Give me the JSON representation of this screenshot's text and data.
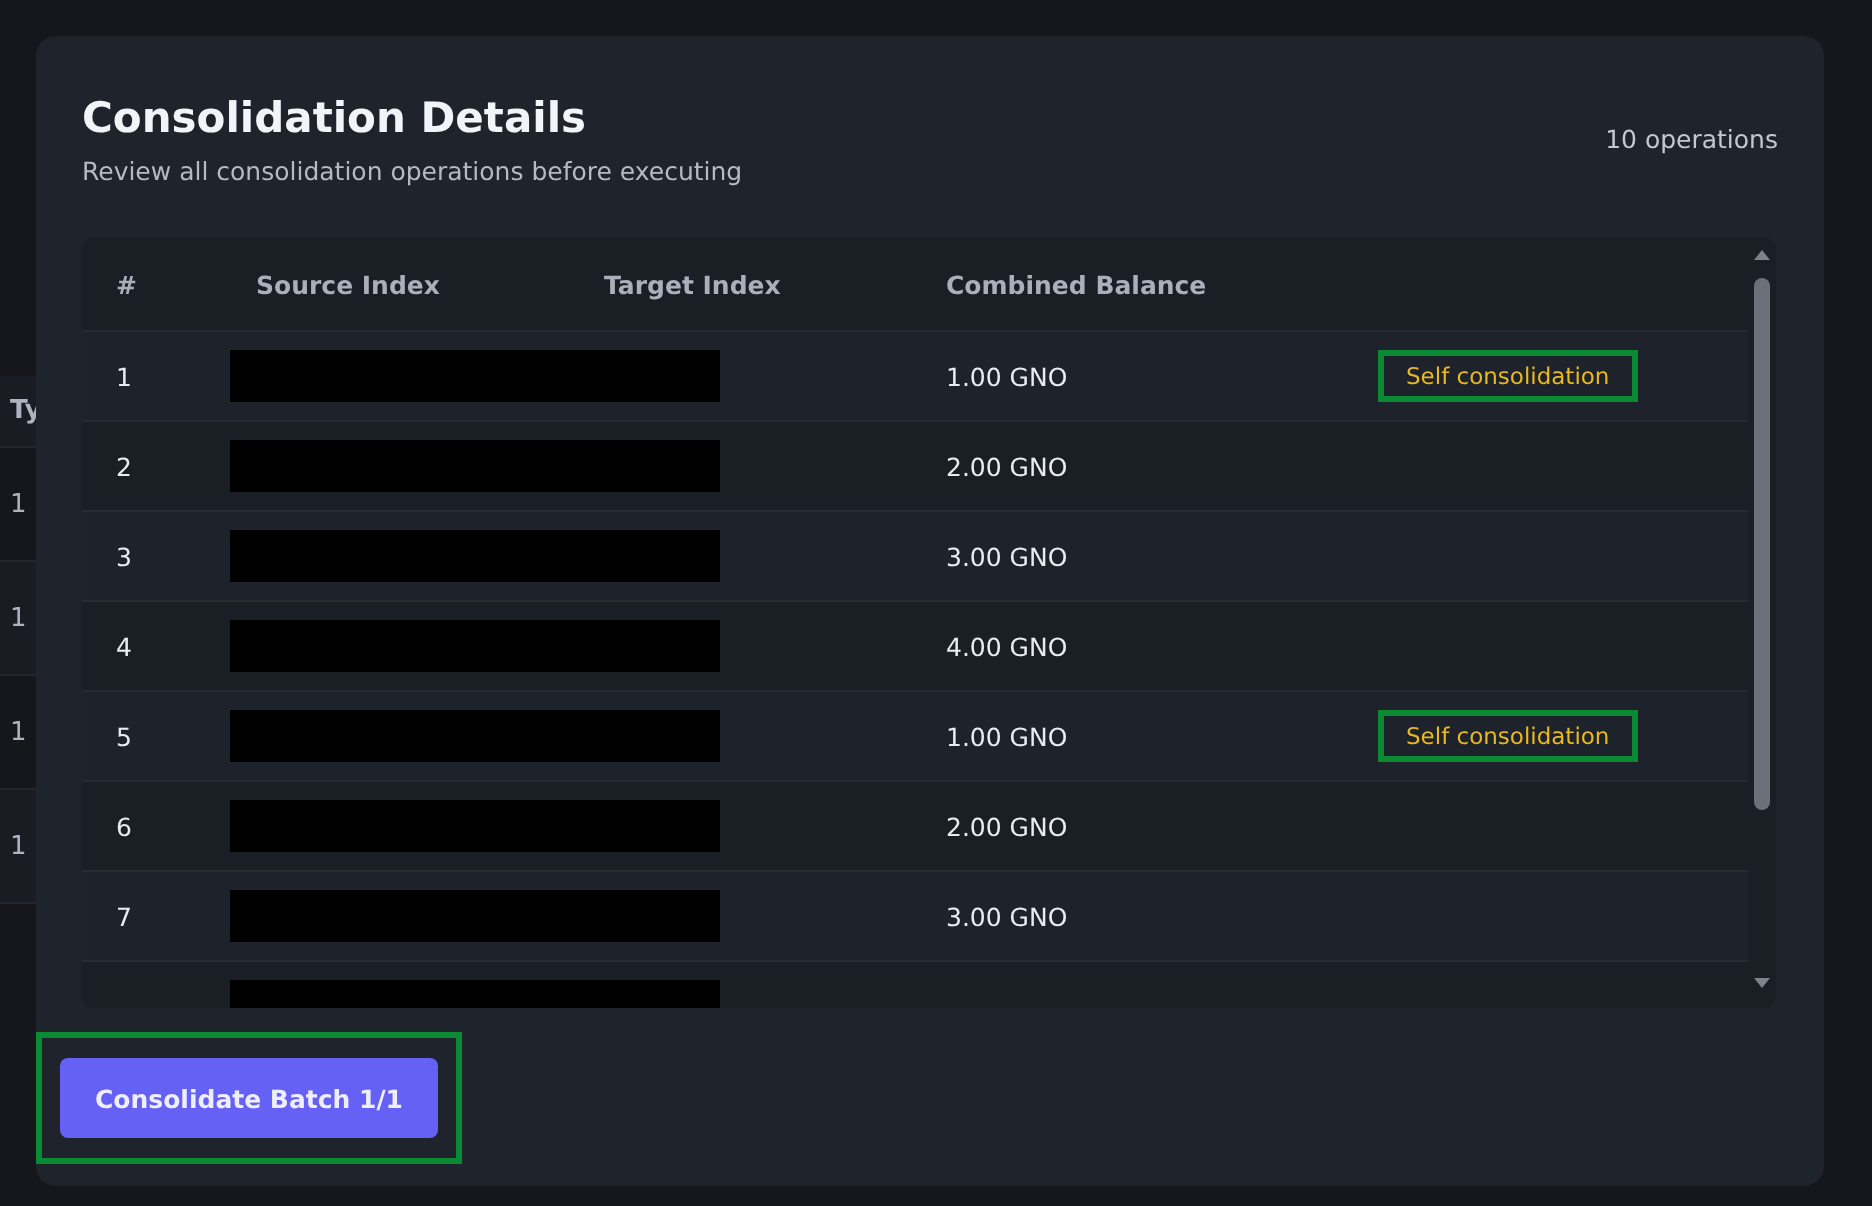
{
  "background_table": {
    "header": "Ty",
    "cells": [
      "1",
      "1",
      "1",
      "1"
    ]
  },
  "modal": {
    "title": "Consolidation Details",
    "subtitle": "Review all consolidation operations before executing",
    "count": "10 operations",
    "table": {
      "columns": [
        "#",
        "Source Index",
        "Target Index",
        "Combined Balance"
      ],
      "rows": [
        {
          "number": "1",
          "redacted": true,
          "balance": "1.00 GNO",
          "badge": "Self consolidation",
          "highlighted": true
        },
        {
          "number": "2",
          "redacted": true,
          "balance": "2.00 GNO"
        },
        {
          "number": "3",
          "redacted": true,
          "balance": "3.00 GNO"
        },
        {
          "number": "4",
          "redacted": true,
          "balance": "4.00 GNO"
        },
        {
          "number": "5",
          "redacted": true,
          "balance": "1.00 GNO",
          "badge": "Self consolidation",
          "highlighted": true
        },
        {
          "number": "6",
          "redacted": true,
          "balance": "2.00 GNO"
        },
        {
          "number": "7",
          "redacted": true,
          "balance": "3.00 GNO"
        },
        {
          "redacted": true
        }
      ]
    },
    "button": {
      "label": "Consolidate Batch 1/1",
      "highlighted": true
    }
  }
}
